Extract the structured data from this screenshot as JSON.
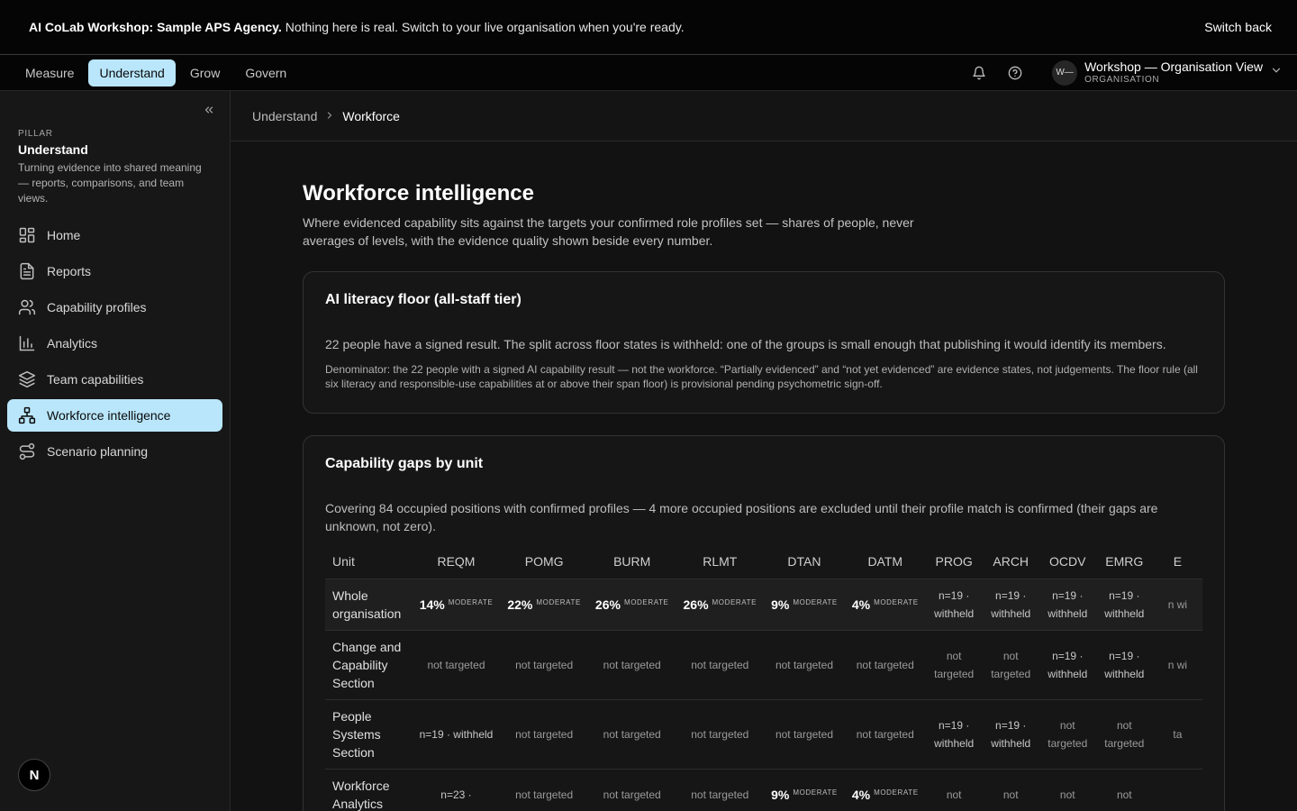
{
  "banner": {
    "strong": "AI CoLab Workshop: Sample APS Agency.",
    "text": "Nothing here is real. Switch to your live organisation when you're ready.",
    "switch_label": "Switch back"
  },
  "topnav": {
    "tabs": [
      "Measure",
      "Understand",
      "Grow",
      "Govern"
    ],
    "active_tab": "Understand",
    "org_initials": "W—",
    "org_name": "Workshop — Organisation View",
    "org_sub": "ORGANISATION"
  },
  "sidebar": {
    "caption": "PILLAR",
    "title": "Understand",
    "description": "Turning evidence into shared meaning — reports, comparisons, and team views.",
    "items": [
      {
        "label": "Home",
        "icon": "grid-icon"
      },
      {
        "label": "Reports",
        "icon": "document-icon"
      },
      {
        "label": "Capability profiles",
        "icon": "users-icon"
      },
      {
        "label": "Analytics",
        "icon": "bar-chart-icon"
      },
      {
        "label": "Team capabilities",
        "icon": "layers-icon"
      },
      {
        "label": "Workforce intelligence",
        "icon": "hierarchy-icon"
      },
      {
        "label": "Scenario planning",
        "icon": "route-icon"
      }
    ],
    "active_item": "Workforce intelligence",
    "badge": "N"
  },
  "breadcrumb": {
    "parent": "Understand",
    "current": "Workforce"
  },
  "page": {
    "title": "Workforce intelligence",
    "lead": "Where evidenced capability sits against the targets your confirmed role profiles set — shares of people, never averages of levels, with the evidence quality shown beside every number."
  },
  "literacy_card": {
    "title": "AI literacy floor (all-staff tier)",
    "body": "22 people have a signed result. The split across floor states is withheld: one of the groups is small enough that publishing it would identify its members.",
    "fine": "Denominator: the 22 people with a signed AI capability result — not the workforce. “Partially evidenced” and “not yet evidenced” are evidence states, not judgements. The floor rule (all six literacy and responsible-use capabilities at or above their span floor) is provisional pending psychometric sign-off."
  },
  "gaps_card": {
    "title": "Capability gaps by unit",
    "body": "Covering 84 occupied positions with confirmed profiles — 4 more occupied positions are excluded until their profile match is confirmed (their gaps are unknown, not zero).",
    "columns": [
      "Unit",
      "REQM",
      "POMG",
      "BURM",
      "RLMT",
      "DTAN",
      "DATM",
      "PROG",
      "ARCH",
      "OCDV",
      "EMRG",
      "E"
    ],
    "rows": [
      {
        "unit": "Whole organisation",
        "cells": [
          {
            "pct": "14%",
            "tag": "MODERATE"
          },
          {
            "pct": "22%",
            "tag": "MODERATE"
          },
          {
            "pct": "26%",
            "tag": "MODERATE"
          },
          {
            "pct": "26%",
            "tag": "MODERATE"
          },
          {
            "pct": "9%",
            "tag": "MODERATE"
          },
          {
            "pct": "4%",
            "tag": "MODERATE"
          },
          {
            "text": "n=19 · withheld"
          },
          {
            "text": "n=19 · withheld"
          },
          {
            "text": "n=19 · withheld"
          },
          {
            "text": "n=19 · withheld"
          },
          {
            "text": "n wi"
          }
        ]
      },
      {
        "unit": "Change and Capability Section",
        "cells": [
          {
            "text": "not targeted"
          },
          {
            "text": "not targeted"
          },
          {
            "text": "not targeted"
          },
          {
            "text": "not targeted"
          },
          {
            "text": "not targeted"
          },
          {
            "text": "not targeted"
          },
          {
            "text": "not targeted"
          },
          {
            "text": "not targeted"
          },
          {
            "text": "n=19 · withheld"
          },
          {
            "text": "n=19 · withheld"
          },
          {
            "text": "n wi"
          }
        ]
      },
      {
        "unit": "People Systems Section",
        "cells": [
          {
            "text": "n=19 · withheld"
          },
          {
            "text": "not targeted"
          },
          {
            "text": "not targeted"
          },
          {
            "text": "not targeted"
          },
          {
            "text": "not targeted"
          },
          {
            "text": "not targeted"
          },
          {
            "text": "n=19 · withheld"
          },
          {
            "text": "n=19 · withheld"
          },
          {
            "text": "not targeted"
          },
          {
            "text": "not targeted"
          },
          {
            "text": "ta"
          }
        ]
      },
      {
        "unit": "Workforce Analytics",
        "cells": [
          {
            "text": "n=23 ·"
          },
          {
            "text": "not targeted"
          },
          {
            "text": "not targeted"
          },
          {
            "text": "not targeted"
          },
          {
            "pct": "9%",
            "tag": "MODERATE"
          },
          {
            "pct": "4%",
            "tag": "MODERATE"
          },
          {
            "text": "not"
          },
          {
            "text": "not"
          },
          {
            "text": "not"
          },
          {
            "text": "not"
          },
          {
            "text": ""
          }
        ]
      }
    ]
  }
}
